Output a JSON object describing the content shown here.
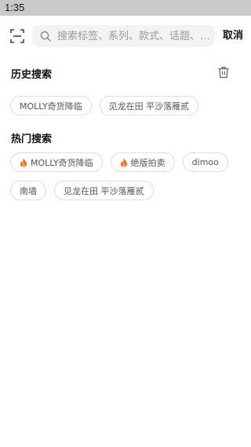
{
  "status_bar": {
    "time": "1:35"
  },
  "search": {
    "placeholder": "搜索标签、系列、款式、话题、…",
    "value": "",
    "cancel_label": "取消"
  },
  "history": {
    "title": "历史搜索",
    "items": [
      {
        "label": "MOLLY奇货降临"
      },
      {
        "label": "见龙在田 平沙落雁贰"
      }
    ]
  },
  "hot": {
    "title": "热门搜索",
    "items": [
      {
        "label": "MOLLY奇货降临",
        "hot": true
      },
      {
        "label": "绝版拍卖",
        "hot": true
      },
      {
        "label": "dimoo",
        "hot": false
      },
      {
        "label": "南墙",
        "hot": false
      },
      {
        "label": "见龙在田 平沙落雁贰",
        "hot": false
      }
    ]
  },
  "colors": {
    "status_bar_bg": "#c9c9c9",
    "search_bg": "#f3f3f3",
    "fire": "#f06a1d",
    "tag_border": "#dedede"
  },
  "icons": {
    "scan": "scan-icon",
    "search": "search-icon",
    "trash": "trash-icon",
    "fire": "fire-icon"
  }
}
